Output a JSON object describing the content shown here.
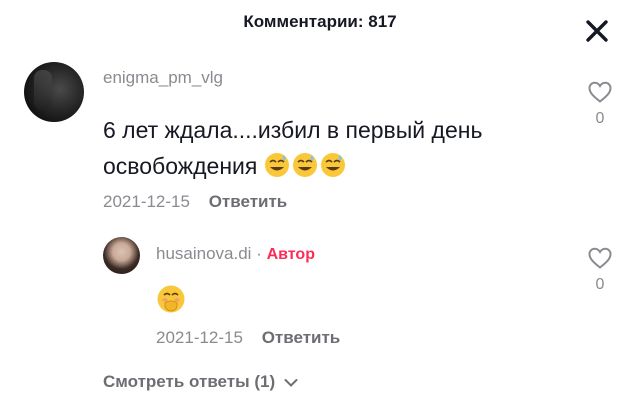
{
  "header": {
    "title": "Комментарии: 817"
  },
  "comments": [
    {
      "username": "enigma_pm_vlg",
      "text": "6 лет ждала....избил в первый день освобождения",
      "emojis": [
        "sweat-smile-emoji",
        "sweat-smile-emoji",
        "sweat-smile-emoji"
      ],
      "date": "2021-12-15",
      "reply_label": "Ответить",
      "likes": "0"
    }
  ],
  "reply": {
    "username": "husainova.di",
    "separator": "·",
    "badge": "Автор",
    "emoji": "hand-over-mouth-emoji",
    "date": "2021-12-15",
    "reply_label": "Ответить",
    "likes": "0"
  },
  "view_replies": "Смотреть ответы (1)",
  "colors": {
    "accent": "#fe2c55",
    "text": "#161823",
    "muted": "#8a8b91"
  }
}
